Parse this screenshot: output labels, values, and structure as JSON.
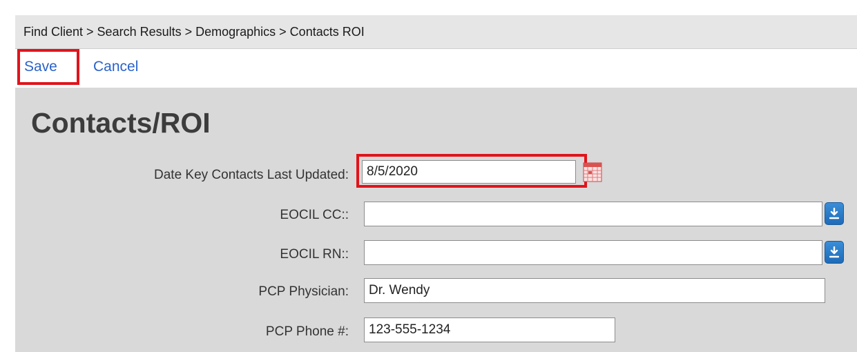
{
  "breadcrumb": "Find Client > Search Results > Demographics > Contacts ROI",
  "toolbar": {
    "save_label": "Save",
    "cancel_label": "Cancel"
  },
  "page_title": "Contacts/ROI",
  "form": {
    "date_updated": {
      "label": "Date Key Contacts Last Updated:",
      "value": "8/5/2020"
    },
    "eocil_cc": {
      "label": "EOCIL CC::",
      "value": ""
    },
    "eocil_rn": {
      "label": "EOCIL RN::",
      "value": ""
    },
    "pcp_physician": {
      "label": "PCP Physician:",
      "value": "Dr. Wendy"
    },
    "pcp_phone": {
      "label": "PCP Phone #:",
      "value": "123-555-1234"
    }
  },
  "icons": {
    "calendar": "calendar-icon",
    "dropdown": "download-arrow-icon"
  },
  "colors": {
    "link": "#2a62c9",
    "highlight": "#e1141b",
    "dropdown_button": "#2f7fd0"
  }
}
